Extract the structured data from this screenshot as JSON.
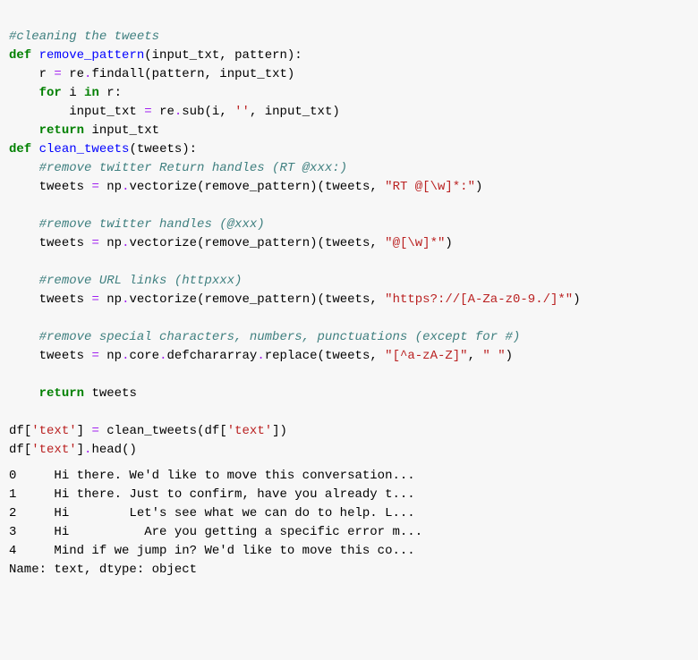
{
  "code": {
    "c1": "#cleaning the tweets",
    "l2_def": "def",
    "l2_fn": "remove_pattern",
    "l2_p1": "input_txt",
    "l2_p2": "pattern",
    "l3_var": "r",
    "l3_eq": "=",
    "l3_mod": "re",
    "l3_dot": ".",
    "l3_call": "findall",
    "l3_a1": "pattern",
    "l3_a2": "input_txt",
    "l4_for": "for",
    "l4_i": "i",
    "l4_in": "in",
    "l4_r": "r",
    "l5_var": "input_txt",
    "l5_eq": "=",
    "l5_mod": "re",
    "l5_dot": ".",
    "l5_call": "sub",
    "l5_a1": "i",
    "l5_a2": "''",
    "l5_a3": "input_txt",
    "l6_ret": "return",
    "l6_val": "input_txt",
    "l7_def": "def",
    "l7_fn": "clean_tweets",
    "l7_p1": "tweets",
    "c8": "#remove twitter Return handles (RT @xxx:)",
    "l9_var": "tweets",
    "l9_eq": "=",
    "l9_np": "np",
    "l9_dot1": ".",
    "l9_vec": "vectorize",
    "l9_rp": "remove_pattern",
    "l9_a1": "tweets",
    "l9_s": "\"RT @[\\w]*:\"",
    "c11": "#remove twitter handles (@xxx)",
    "l12_var": "tweets",
    "l12_eq": "=",
    "l12_np": "np",
    "l12_dot1": ".",
    "l12_vec": "vectorize",
    "l12_rp": "remove_pattern",
    "l12_a1": "tweets",
    "l12_s": "\"@[\\w]*\"",
    "c14": "#remove URL links (httpxxx)",
    "l15_var": "tweets",
    "l15_eq": "=",
    "l15_np": "np",
    "l15_dot1": ".",
    "l15_vec": "vectorize",
    "l15_rp": "remove_pattern",
    "l15_a1": "tweets",
    "l15_s": "\"https?://[A-Za-z0-9./]*\"",
    "c17": "#remove special characters, numbers, punctuations (except for #)",
    "l18_var": "tweets",
    "l18_eq": "=",
    "l18_np": "np",
    "l18_dot1": ".",
    "l18_core": "core",
    "l18_dot2": ".",
    "l18_dca": "defchararray",
    "l18_dot3": ".",
    "l18_rep": "replace",
    "l18_a1": "tweets",
    "l18_s1": "\"[^a-zA-Z]\"",
    "l18_s2": "\" \"",
    "l20_ret": "return",
    "l20_val": "tweets",
    "l22_df": "df",
    "l22_k": "'text'",
    "l22_eq": "=",
    "l22_fn": "clean_tweets",
    "l22_df2": "df",
    "l22_k2": "'text'",
    "l23_df": "df",
    "l23_k": "'text'",
    "l23_dot": ".",
    "l23_head": "head"
  },
  "output": {
    "rows": [
      {
        "idx": "0",
        "text": "Hi there. We'd like to move this conversation..."
      },
      {
        "idx": "1",
        "text": "Hi there. Just to confirm, have you already t..."
      },
      {
        "idx": "2",
        "text": "Hi        Let's see what we can do to help. L..."
      },
      {
        "idx": "3",
        "text": "Hi          Are you getting a specific error m..."
      },
      {
        "idx": "4",
        "text": "Mind if we jump in? We'd like to move this co..."
      }
    ],
    "footer": "Name: text, dtype: object"
  }
}
